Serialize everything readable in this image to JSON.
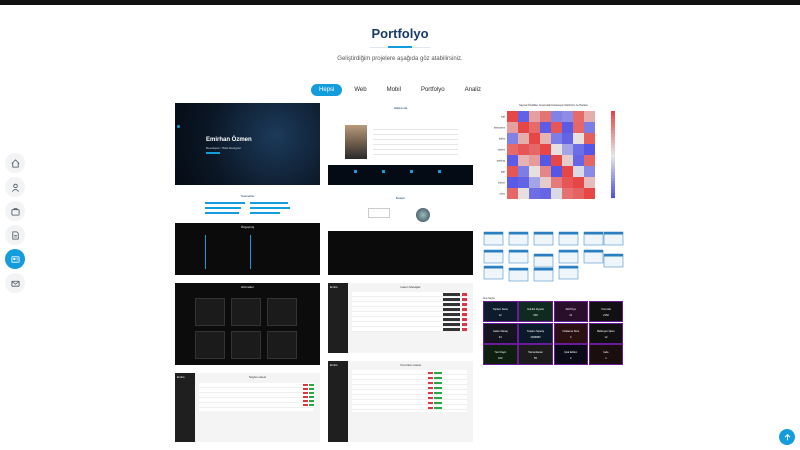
{
  "section": {
    "title": "Portfolyo",
    "subtitle": "Geliştirdiğim projelere aşağıda göz atabilirsiniz."
  },
  "filters": [
    {
      "label": "Hepsi",
      "active": true
    },
    {
      "label": "Web",
      "active": false
    },
    {
      "label": "Mobil",
      "active": false
    },
    {
      "label": "Portfolyo",
      "active": false
    },
    {
      "label": "Analiz",
      "active": false
    }
  ],
  "sidenav": [
    {
      "icon": "home-icon"
    },
    {
      "icon": "user-icon"
    },
    {
      "icon": "briefcase-icon"
    },
    {
      "icon": "document-icon"
    },
    {
      "icon": "portfolio-icon",
      "active": true
    },
    {
      "icon": "envelope-icon"
    }
  ],
  "portfolio": {
    "hero_name": "Emirhan Özmen",
    "hero_role": "Developer / Web Designer",
    "about_title": "Hakkımda",
    "skills_title": "Yetenekler",
    "resume_title": "Özgeçmiş",
    "services_title": "Hizmetler",
    "pages_title": "Sayfa Listesi",
    "contact_title": "İletişim",
    "admin_brand": "Emirs",
    "messages_title": "Gelen Mesajlar",
    "tests_title": "Yorumlar Listesi",
    "heatmap_title": "Sayısal Özellikler Arasındaki Korelasyon Matrisinin Isı Haritası",
    "stats_title": "Ana Sayfa",
    "heat_labels": [
      "sqft",
      "bedrooms",
      "baths",
      "stories",
      "parking",
      "age",
      "lotsize",
      "price"
    ]
  },
  "dashboard_cells": [
    {
      "label": "Toplam Satış",
      "value": "12"
    },
    {
      "label": "Günlük Ziyaret",
      "value": "648"
    },
    {
      "label": "Aktif Üye",
      "value": "41"
    },
    {
      "label": "Yorumlar",
      "value": "2152"
    },
    {
      "label": "Gelen Mesaj",
      "value": "24"
    },
    {
      "label": "Toplam Sipariş",
      "value": "2096880"
    },
    {
      "label": "Ortalama Süre",
      "value": "4"
    },
    {
      "label": "Bekleyen İşlem",
      "value": "12"
    },
    {
      "label": "Yeni Kayıt",
      "value": "100"
    },
    {
      "label": "Tamamlanan",
      "value": "55"
    },
    {
      "label": "İptal Edilen",
      "value": "3"
    },
    {
      "label": "İade",
      "value": "1"
    }
  ],
  "colors": {
    "accent": "#149ddd",
    "dark": "#040b14",
    "title": "#173b6c"
  }
}
